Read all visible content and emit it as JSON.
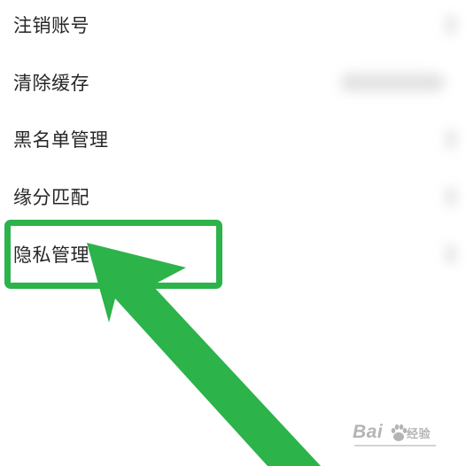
{
  "settings": {
    "items": [
      {
        "label": "注销账号"
      },
      {
        "label": "清除缓存"
      },
      {
        "label": "黑名单管理"
      },
      {
        "label": "缘分匹配"
      },
      {
        "label": "隐私管理"
      }
    ]
  },
  "annotation": {
    "color": "#2cb34a",
    "highlighted_item": "隐私管理",
    "arrow_icon": "arrow-up-left-icon"
  },
  "watermark": {
    "brand": "Bai",
    "suffix": "经验",
    "icon": "paw-icon"
  }
}
